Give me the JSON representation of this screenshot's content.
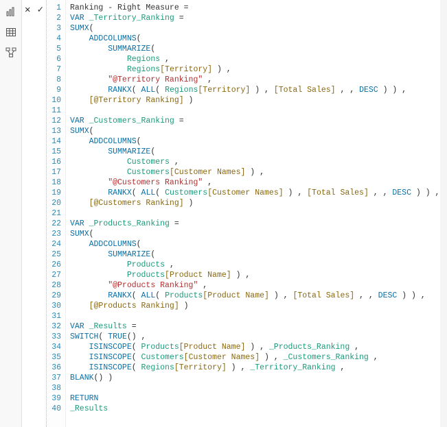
{
  "rail": {
    "chart_icon": "chart-icon",
    "table_icon": "table-icon",
    "model_icon": "model-icon"
  },
  "toolbar": {
    "cancel_label": "✕",
    "commit_label": "✓"
  },
  "code": {
    "lines": [
      {
        "n": 1,
        "tokens": [
          [
            "plain",
            "Ranking - Right Measure ="
          ]
        ]
      },
      {
        "n": 2,
        "tokens": [
          [
            "kw",
            "VAR "
          ],
          [
            "ident",
            "_Territory_Ranking"
          ],
          [
            "plain",
            " ="
          ]
        ]
      },
      {
        "n": 3,
        "tokens": [
          [
            "func",
            "SUMX"
          ],
          [
            "punct",
            "("
          ]
        ]
      },
      {
        "n": 4,
        "tokens": [
          [
            "plain",
            "    "
          ],
          [
            "func",
            "ADDCOLUMNS"
          ],
          [
            "punct",
            "("
          ]
        ]
      },
      {
        "n": 5,
        "tokens": [
          [
            "plain",
            "        "
          ],
          [
            "func",
            "SUMMARIZE"
          ],
          [
            "punct",
            "("
          ]
        ]
      },
      {
        "n": 6,
        "tokens": [
          [
            "plain",
            "            "
          ],
          [
            "ident",
            "Regions"
          ],
          [
            "plain",
            " ,"
          ]
        ]
      },
      {
        "n": 7,
        "tokens": [
          [
            "plain",
            "            "
          ],
          [
            "ident",
            "Regions"
          ],
          [
            "col",
            "[Territory]"
          ],
          [
            "plain",
            " ) ,"
          ]
        ]
      },
      {
        "n": 8,
        "tokens": [
          [
            "plain",
            "        "
          ],
          [
            "str",
            "\"@Territory Ranking\""
          ],
          [
            "plain",
            " ,"
          ]
        ]
      },
      {
        "n": 9,
        "tokens": [
          [
            "plain",
            "        "
          ],
          [
            "func",
            "RANKX"
          ],
          [
            "punct",
            "( "
          ],
          [
            "func",
            "ALL"
          ],
          [
            "punct",
            "( "
          ],
          [
            "ident",
            "Regions"
          ],
          [
            "col",
            "[Territory]"
          ],
          [
            "plain",
            " ) , "
          ],
          [
            "col",
            "[Total Sales]"
          ],
          [
            "plain",
            " , , "
          ],
          [
            "kw",
            "DESC"
          ],
          [
            "plain",
            " ) ) ,"
          ]
        ]
      },
      {
        "n": 10,
        "tokens": [
          [
            "plain",
            "    "
          ],
          [
            "col",
            "[@Territory Ranking]"
          ],
          [
            "plain",
            " )"
          ]
        ]
      },
      {
        "n": 11,
        "tokens": [
          [
            "plain",
            ""
          ]
        ]
      },
      {
        "n": 12,
        "tokens": [
          [
            "kw",
            "VAR "
          ],
          [
            "ident",
            "_Customers_Ranking"
          ],
          [
            "plain",
            " ="
          ]
        ]
      },
      {
        "n": 13,
        "tokens": [
          [
            "func",
            "SUMX"
          ],
          [
            "punct",
            "("
          ]
        ]
      },
      {
        "n": 14,
        "tokens": [
          [
            "plain",
            "    "
          ],
          [
            "func",
            "ADDCOLUMNS"
          ],
          [
            "punct",
            "("
          ]
        ]
      },
      {
        "n": 15,
        "tokens": [
          [
            "plain",
            "        "
          ],
          [
            "func",
            "SUMMARIZE"
          ],
          [
            "punct",
            "("
          ]
        ]
      },
      {
        "n": 16,
        "tokens": [
          [
            "plain",
            "            "
          ],
          [
            "ident",
            "Customers"
          ],
          [
            "plain",
            " ,"
          ]
        ]
      },
      {
        "n": 17,
        "tokens": [
          [
            "plain",
            "            "
          ],
          [
            "ident",
            "Customers"
          ],
          [
            "col",
            "[Customer Names]"
          ],
          [
            "plain",
            " ) ,"
          ]
        ]
      },
      {
        "n": 18,
        "tokens": [
          [
            "plain",
            "        "
          ],
          [
            "str",
            "\"@Customers Ranking\""
          ],
          [
            "plain",
            " ,"
          ]
        ]
      },
      {
        "n": 19,
        "tokens": [
          [
            "plain",
            "        "
          ],
          [
            "func",
            "RANKX"
          ],
          [
            "punct",
            "( "
          ],
          [
            "func",
            "ALL"
          ],
          [
            "punct",
            "( "
          ],
          [
            "ident",
            "Customers"
          ],
          [
            "col",
            "[Customer Names]"
          ],
          [
            "plain",
            " ) , "
          ],
          [
            "col",
            "[Total Sales]"
          ],
          [
            "plain",
            " , , "
          ],
          [
            "kw",
            "DESC"
          ],
          [
            "plain",
            " ) ) ,"
          ]
        ]
      },
      {
        "n": 20,
        "tokens": [
          [
            "plain",
            "    "
          ],
          [
            "col",
            "[@Customers Ranking]"
          ],
          [
            "plain",
            " )"
          ]
        ]
      },
      {
        "n": 21,
        "tokens": [
          [
            "plain",
            ""
          ]
        ]
      },
      {
        "n": 22,
        "tokens": [
          [
            "kw",
            "VAR "
          ],
          [
            "ident",
            "_Products_Ranking"
          ],
          [
            "plain",
            " ="
          ]
        ]
      },
      {
        "n": 23,
        "tokens": [
          [
            "func",
            "SUMX"
          ],
          [
            "punct",
            "("
          ]
        ]
      },
      {
        "n": 24,
        "tokens": [
          [
            "plain",
            "    "
          ],
          [
            "func",
            "ADDCOLUMNS"
          ],
          [
            "punct",
            "("
          ]
        ]
      },
      {
        "n": 25,
        "tokens": [
          [
            "plain",
            "        "
          ],
          [
            "func",
            "SUMMARIZE"
          ],
          [
            "punct",
            "("
          ]
        ]
      },
      {
        "n": 26,
        "tokens": [
          [
            "plain",
            "            "
          ],
          [
            "ident",
            "Products"
          ],
          [
            "plain",
            " ,"
          ]
        ]
      },
      {
        "n": 27,
        "tokens": [
          [
            "plain",
            "            "
          ],
          [
            "ident",
            "Products"
          ],
          [
            "col",
            "[Product Name]"
          ],
          [
            "plain",
            " ) ,"
          ]
        ]
      },
      {
        "n": 28,
        "tokens": [
          [
            "plain",
            "        "
          ],
          [
            "str",
            "\"@Products Ranking\""
          ],
          [
            "plain",
            " ,"
          ]
        ]
      },
      {
        "n": 29,
        "tokens": [
          [
            "plain",
            "        "
          ],
          [
            "func",
            "RANKX"
          ],
          [
            "punct",
            "( "
          ],
          [
            "func",
            "ALL"
          ],
          [
            "punct",
            "( "
          ],
          [
            "ident",
            "Products"
          ],
          [
            "col",
            "[Product Name]"
          ],
          [
            "plain",
            " ) , "
          ],
          [
            "col",
            "[Total Sales]"
          ],
          [
            "plain",
            " , , "
          ],
          [
            "kw",
            "DESC"
          ],
          [
            "plain",
            " ) ) ,"
          ]
        ]
      },
      {
        "n": 30,
        "tokens": [
          [
            "plain",
            "    "
          ],
          [
            "col",
            "[@Products Ranking]"
          ],
          [
            "plain",
            " )"
          ]
        ]
      },
      {
        "n": 31,
        "tokens": [
          [
            "plain",
            ""
          ]
        ]
      },
      {
        "n": 32,
        "tokens": [
          [
            "kw",
            "VAR "
          ],
          [
            "ident",
            "_Results"
          ],
          [
            "plain",
            " ="
          ]
        ]
      },
      {
        "n": 33,
        "tokens": [
          [
            "func",
            "SWITCH"
          ],
          [
            "punct",
            "( "
          ],
          [
            "func",
            "TRUE"
          ],
          [
            "punct",
            "() ,"
          ]
        ]
      },
      {
        "n": 34,
        "tokens": [
          [
            "plain",
            "    "
          ],
          [
            "func",
            "ISINSCOPE"
          ],
          [
            "punct",
            "( "
          ],
          [
            "ident",
            "Products"
          ],
          [
            "col",
            "[Product Name]"
          ],
          [
            "plain",
            " ) , "
          ],
          [
            "ident",
            "_Products_Ranking"
          ],
          [
            "plain",
            " ,"
          ]
        ]
      },
      {
        "n": 35,
        "tokens": [
          [
            "plain",
            "    "
          ],
          [
            "func",
            "ISINSCOPE"
          ],
          [
            "punct",
            "( "
          ],
          [
            "ident",
            "Customers"
          ],
          [
            "col",
            "[Customer Names]"
          ],
          [
            "plain",
            " ) , "
          ],
          [
            "ident",
            "_Customers_Ranking"
          ],
          [
            "plain",
            " ,"
          ]
        ]
      },
      {
        "n": 36,
        "tokens": [
          [
            "plain",
            "    "
          ],
          [
            "func",
            "ISINSCOPE"
          ],
          [
            "punct",
            "( "
          ],
          [
            "ident",
            "Regions"
          ],
          [
            "col",
            "[Territory]"
          ],
          [
            "plain",
            " ) , "
          ],
          [
            "ident",
            "_Territory_Ranking"
          ],
          [
            "plain",
            " ,"
          ]
        ]
      },
      {
        "n": 37,
        "tokens": [
          [
            "func",
            "BLANK"
          ],
          [
            "punct",
            "() )"
          ]
        ]
      },
      {
        "n": 38,
        "tokens": [
          [
            "plain",
            ""
          ]
        ]
      },
      {
        "n": 39,
        "tokens": [
          [
            "kw",
            "RETURN"
          ]
        ]
      },
      {
        "n": 40,
        "tokens": [
          [
            "ident",
            "_Results"
          ]
        ]
      }
    ]
  }
}
